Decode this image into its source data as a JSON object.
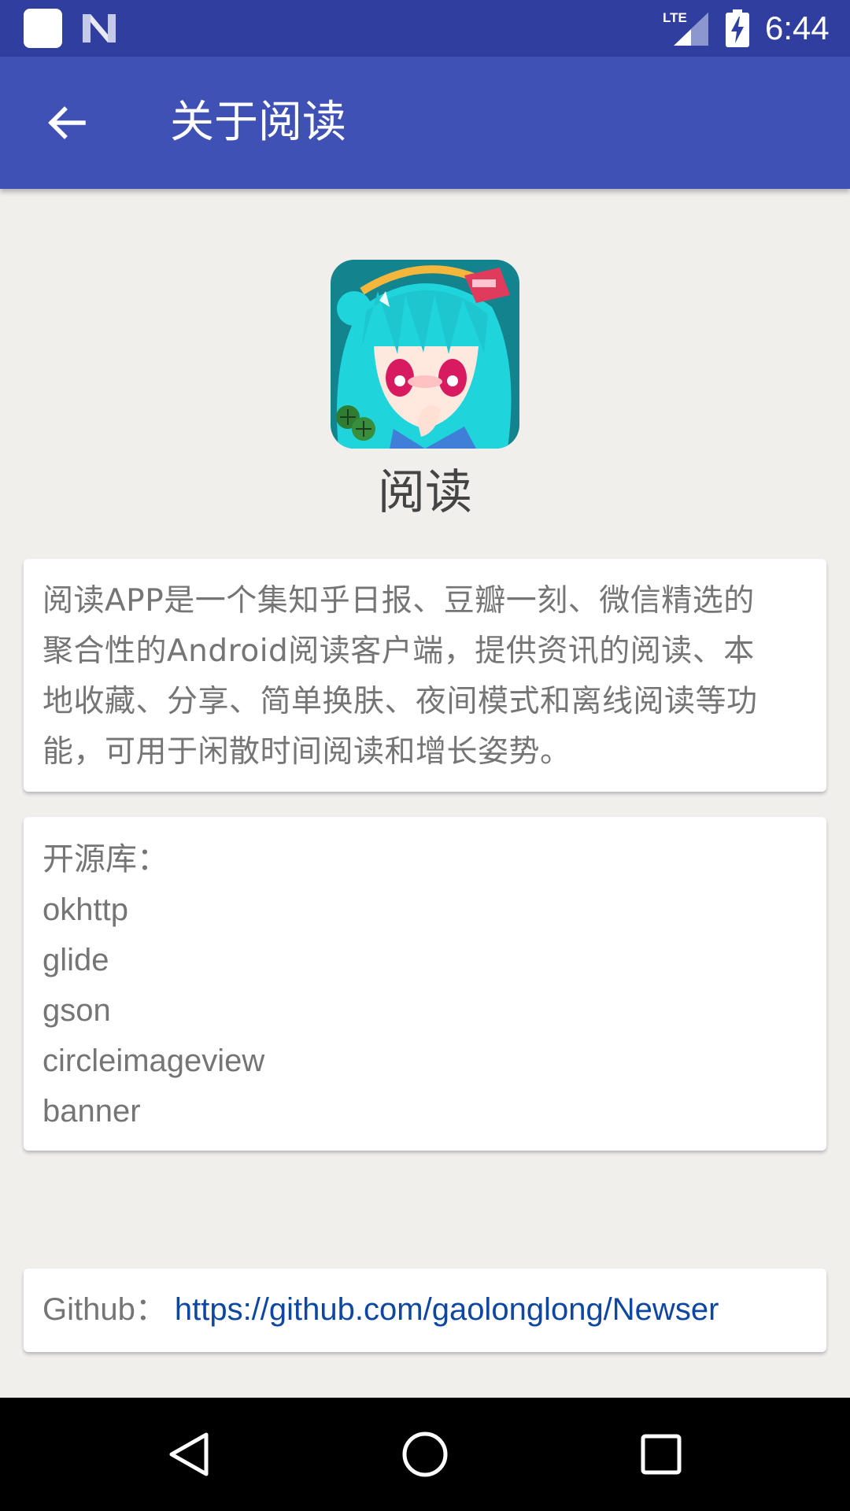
{
  "status_bar": {
    "time": "6:44",
    "network_label": "LTE",
    "icons": [
      "notification-square-icon",
      "n-logo-icon",
      "lte-signal-icon",
      "battery-charging-icon"
    ]
  },
  "toolbar": {
    "title": "关于阅读",
    "back_icon": "arrow-left-icon"
  },
  "app": {
    "name": "阅读",
    "icon": "anime-girl-app-icon"
  },
  "description": {
    "lines": [
      "阅读APP是一个集知乎日报、豆瓣一刻、微信精选的",
      "聚合性的Android阅读客户端，提供资讯的阅读、本",
      "地收藏、分享、简单换肤、夜间模式和离线阅读等功",
      "能，可用于闲散时间阅读和增长姿势。"
    ]
  },
  "libraries": {
    "title": "开源库：",
    "items": [
      "okhttp",
      "glide",
      "gson",
      "circleimageview",
      "banner"
    ]
  },
  "github": {
    "label": "Github：",
    "url": "https://github.com/gaolonglong/Newser"
  },
  "nav_bar": {
    "icons": [
      "back-triangle-icon",
      "home-circle-icon",
      "recents-square-icon"
    ]
  },
  "colors": {
    "status_bar": "#303f9f",
    "toolbar": "#3f51b5",
    "background": "#f1efec",
    "link": "#0d47a1",
    "text": "#757575"
  }
}
